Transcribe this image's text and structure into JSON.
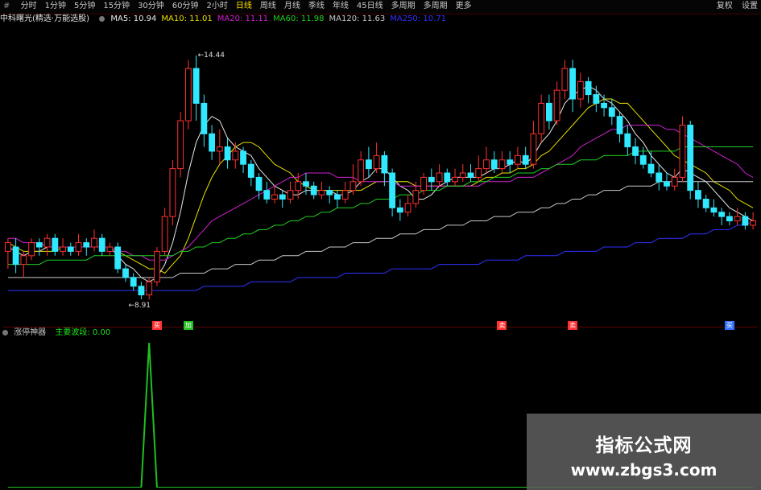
{
  "toolbar": {
    "first": "#",
    "periods": [
      "分时",
      "1分钟",
      "5分钟",
      "15分钟",
      "30分钟",
      "60分钟",
      "2小时",
      "日线",
      "周线",
      "月线",
      "季线",
      "年线",
      "45日线",
      "多周期",
      "多周期",
      "更多"
    ],
    "active_index": 7,
    "right": [
      "复权",
      "设置"
    ]
  },
  "legend": {
    "title": "中科曙光(精选·万能选股)",
    "items": [
      {
        "label": "MA5: 10.94",
        "color": "#e8e8e8"
      },
      {
        "label": "MA10: 11.01",
        "color": "#e8e000"
      },
      {
        "label": "MA20: 11.11",
        "color": "#d020d0"
      },
      {
        "label": "MA60: 11.98",
        "color": "#20d020"
      },
      {
        "label": "MA120: 11.63",
        "color": "#c8c8c8"
      },
      {
        "label": "MA250: 10.71",
        "color": "#3030ff"
      }
    ]
  },
  "price_labels": {
    "high": "14.44",
    "low": "8.91"
  },
  "signals": [
    {
      "text": "买",
      "color": "#ff3030"
    },
    {
      "text": "加",
      "color": "#20c020"
    },
    {
      "text": "卖",
      "color": "#ff3030"
    },
    {
      "text": "卖",
      "color": "#ff3030"
    },
    {
      "text": "买",
      "color": "#3070ff"
    }
  ],
  "sub": {
    "title": "涨停神器",
    "value_label": "主要波段: 0.00"
  },
  "watermark": {
    "cn": "指标公式网",
    "url": "www.zbgs3.com"
  },
  "chart_data": {
    "type": "candlestick",
    "ylim": [
      8.4,
      15.2
    ],
    "candles": [
      [
        10.0,
        10.2,
        9.6,
        10.3
      ],
      [
        10.1,
        9.7,
        9.5,
        10.3
      ],
      [
        9.7,
        9.9,
        9.4,
        10.0
      ],
      [
        9.9,
        10.2,
        9.8,
        10.3
      ],
      [
        10.2,
        10.1,
        9.9,
        10.3
      ],
      [
        10.1,
        10.3,
        9.9,
        10.4
      ],
      [
        10.3,
        10.0,
        9.9,
        10.4
      ],
      [
        10.0,
        10.1,
        9.9,
        10.3
      ],
      [
        10.1,
        10.0,
        9.9,
        10.2
      ],
      [
        10.0,
        10.2,
        9.9,
        10.4
      ],
      [
        10.2,
        10.1,
        9.9,
        10.3
      ],
      [
        10.1,
        10.3,
        10.0,
        10.5
      ],
      [
        10.3,
        10.0,
        9.9,
        10.4
      ],
      [
        10.0,
        10.1,
        9.9,
        10.2
      ],
      [
        10.1,
        9.6,
        9.5,
        10.2
      ],
      [
        9.6,
        9.4,
        9.3,
        9.7
      ],
      [
        9.4,
        9.2,
        9.1,
        9.5
      ],
      [
        9.2,
        9.0,
        8.9,
        9.3
      ],
      [
        9.0,
        9.3,
        8.9,
        9.4
      ],
      [
        9.3,
        10.0,
        9.2,
        10.1
      ],
      [
        10.0,
        10.8,
        9.9,
        11.0
      ],
      [
        10.8,
        11.9,
        10.6,
        12.1
      ],
      [
        11.9,
        13.0,
        11.7,
        13.2
      ],
      [
        13.0,
        14.2,
        12.8,
        14.4
      ],
      [
        14.2,
        13.4,
        13.0,
        14.5
      ],
      [
        13.4,
        12.7,
        12.4,
        13.6
      ],
      [
        12.7,
        12.3,
        12.1,
        12.9
      ],
      [
        12.3,
        12.4,
        12.0,
        12.8
      ],
      [
        12.4,
        12.1,
        11.9,
        12.6
      ],
      [
        12.1,
        12.3,
        11.9,
        12.5
      ],
      [
        12.3,
        12.0,
        11.8,
        12.4
      ],
      [
        12.0,
        11.7,
        11.5,
        12.1
      ],
      [
        11.7,
        11.4,
        11.2,
        11.8
      ],
      [
        11.4,
        11.2,
        11.1,
        11.6
      ],
      [
        11.2,
        11.3,
        11.1,
        11.5
      ],
      [
        11.3,
        11.2,
        11.0,
        11.4
      ],
      [
        11.2,
        11.4,
        11.1,
        11.6
      ],
      [
        11.4,
        11.6,
        11.2,
        11.8
      ],
      [
        11.6,
        11.5,
        11.3,
        11.8
      ],
      [
        11.5,
        11.3,
        11.2,
        11.6
      ],
      [
        11.3,
        11.4,
        11.2,
        11.6
      ],
      [
        11.4,
        11.3,
        11.1,
        11.5
      ],
      [
        11.3,
        11.2,
        11.0,
        11.4
      ],
      [
        11.2,
        11.4,
        11.1,
        11.6
      ],
      [
        11.4,
        11.6,
        11.3,
        12.0
      ],
      [
        11.6,
        12.1,
        11.5,
        12.3
      ],
      [
        12.1,
        11.9,
        11.7,
        12.4
      ],
      [
        11.9,
        12.2,
        11.8,
        12.5
      ],
      [
        12.2,
        11.8,
        11.5,
        12.3
      ],
      [
        11.8,
        11.0,
        10.8,
        11.9
      ],
      [
        11.0,
        10.9,
        10.7,
        11.2
      ],
      [
        10.9,
        11.1,
        10.8,
        11.3
      ],
      [
        11.1,
        11.4,
        11.0,
        11.6
      ],
      [
        11.4,
        11.7,
        11.3,
        11.8
      ],
      [
        11.7,
        11.6,
        11.4,
        11.9
      ],
      [
        11.6,
        11.8,
        11.5,
        12.0
      ],
      [
        11.8,
        11.6,
        11.5,
        11.9
      ],
      [
        11.6,
        11.7,
        11.5,
        11.9
      ],
      [
        11.7,
        11.8,
        11.6,
        12.0
      ],
      [
        11.8,
        11.7,
        11.6,
        12.0
      ],
      [
        11.7,
        11.9,
        11.6,
        12.2
      ],
      [
        11.9,
        12.1,
        11.8,
        12.4
      ],
      [
        12.1,
        11.9,
        11.8,
        12.3
      ],
      [
        11.9,
        12.1,
        11.8,
        12.3
      ],
      [
        12.1,
        12.0,
        11.8,
        12.3
      ],
      [
        12.0,
        12.2,
        11.9,
        12.4
      ],
      [
        12.2,
        12.0,
        11.9,
        12.4
      ],
      [
        12.0,
        12.7,
        11.9,
        13.0
      ],
      [
        12.7,
        13.4,
        12.5,
        13.6
      ],
      [
        13.4,
        13.0,
        12.8,
        13.6
      ],
      [
        13.0,
        13.7,
        12.9,
        13.9
      ],
      [
        13.7,
        14.2,
        13.5,
        14.4
      ],
      [
        14.2,
        13.5,
        13.2,
        14.4
      ],
      [
        13.5,
        13.9,
        13.3,
        14.1
      ],
      [
        13.9,
        13.6,
        13.4,
        14.0
      ],
      [
        13.6,
        13.4,
        13.2,
        13.8
      ],
      [
        13.4,
        13.3,
        13.1,
        13.6
      ],
      [
        13.3,
        13.1,
        12.9,
        13.5
      ],
      [
        13.1,
        12.7,
        12.5,
        13.2
      ],
      [
        12.7,
        12.4,
        12.2,
        12.9
      ],
      [
        12.4,
        12.2,
        12.0,
        12.6
      ],
      [
        12.2,
        12.0,
        11.9,
        12.4
      ],
      [
        12.0,
        11.8,
        11.7,
        12.3
      ],
      [
        11.8,
        11.6,
        11.4,
        12.0
      ],
      [
        11.6,
        11.5,
        11.4,
        11.8
      ],
      [
        11.5,
        11.7,
        11.4,
        11.9
      ],
      [
        11.7,
        12.9,
        11.6,
        13.1
      ],
      [
        12.9,
        11.4,
        11.2,
        13.0
      ],
      [
        11.4,
        11.2,
        11.0,
        11.6
      ],
      [
        11.2,
        11.0,
        10.9,
        11.3
      ],
      [
        11.0,
        10.9,
        10.8,
        11.2
      ],
      [
        10.9,
        10.8,
        10.6,
        11.0
      ],
      [
        10.8,
        10.7,
        10.6,
        10.9
      ],
      [
        10.7,
        10.8,
        10.6,
        11.0
      ],
      [
        10.8,
        10.6,
        10.5,
        10.9
      ],
      [
        10.6,
        10.7,
        10.5,
        10.9
      ]
    ],
    "ma": [
      {
        "name": "MA5",
        "color": "#e8e8e8",
        "values": [
          10.1,
          10.0,
          9.9,
          10.0,
          10.0,
          10.1,
          10.1,
          10.1,
          10.1,
          10.1,
          10.1,
          10.1,
          10.1,
          10.1,
          9.9,
          9.7,
          9.6,
          9.4,
          9.3,
          9.4,
          9.7,
          10.2,
          10.9,
          11.8,
          12.5,
          12.9,
          13.1,
          13.0,
          12.6,
          12.4,
          12.3,
          12.2,
          11.9,
          11.7,
          11.5,
          11.4,
          11.3,
          11.3,
          11.4,
          11.4,
          11.4,
          11.4,
          11.3,
          11.3,
          11.4,
          11.6,
          11.7,
          11.9,
          11.9,
          11.7,
          11.5,
          11.4,
          11.2,
          11.2,
          11.3,
          11.5,
          11.6,
          11.7,
          11.7,
          11.7,
          11.7,
          11.8,
          11.9,
          11.9,
          12.0,
          12.1,
          12.0,
          12.2,
          12.5,
          12.7,
          13.0,
          13.4,
          13.6,
          13.7,
          13.8,
          13.7,
          13.5,
          13.4,
          13.2,
          13.0,
          12.7,
          12.5,
          12.2,
          12.0,
          11.8,
          11.7,
          11.9,
          11.8,
          11.7,
          11.6,
          11.4,
          11.2,
          11.0,
          10.9,
          10.8,
          10.7
        ]
      },
      {
        "name": "MA10",
        "color": "#e8e000",
        "values": [
          10.2,
          10.1,
          10.0,
          10.0,
          10.0,
          10.0,
          10.0,
          10.1,
          10.1,
          10.1,
          10.1,
          10.1,
          10.1,
          10.1,
          10.0,
          9.9,
          9.8,
          9.7,
          9.6,
          9.6,
          9.5,
          9.7,
          9.9,
          10.3,
          10.8,
          11.3,
          11.7,
          12.0,
          12.2,
          12.4,
          12.5,
          12.5,
          12.4,
          12.2,
          12.0,
          11.9,
          11.8,
          11.6,
          11.5,
          11.4,
          11.4,
          11.4,
          11.4,
          11.4,
          11.4,
          11.4,
          11.5,
          11.6,
          11.6,
          11.6,
          11.6,
          11.6,
          11.5,
          11.5,
          11.5,
          11.5,
          11.5,
          11.5,
          11.5,
          11.5,
          11.6,
          11.7,
          11.7,
          11.8,
          11.8,
          11.9,
          11.9,
          12.0,
          12.2,
          12.3,
          12.5,
          12.7,
          12.9,
          13.1,
          13.3,
          13.4,
          13.5,
          13.5,
          13.4,
          13.4,
          13.2,
          13.0,
          12.8,
          12.6,
          12.4,
          12.2,
          12.1,
          12.0,
          11.9,
          11.8,
          11.6,
          11.5,
          11.4,
          11.2,
          11.1,
          11.0
        ]
      },
      {
        "name": "MA20",
        "color": "#d020d0",
        "values": [
          10.3,
          10.3,
          10.2,
          10.2,
          10.2,
          10.1,
          10.1,
          10.1,
          10.1,
          10.1,
          10.1,
          10.1,
          10.1,
          10.1,
          10.0,
          10.0,
          9.9,
          9.9,
          9.8,
          9.8,
          9.8,
          9.9,
          10.0,
          10.1,
          10.3,
          10.5,
          10.7,
          10.8,
          10.9,
          11.0,
          11.1,
          11.2,
          11.3,
          11.4,
          11.5,
          11.6,
          11.7,
          11.7,
          11.8,
          11.8,
          11.8,
          11.8,
          11.7,
          11.7,
          11.7,
          11.6,
          11.6,
          11.6,
          11.6,
          11.6,
          11.5,
          11.5,
          11.5,
          11.5,
          11.5,
          11.5,
          11.5,
          11.5,
          11.5,
          11.5,
          11.5,
          11.6,
          11.6,
          11.6,
          11.6,
          11.7,
          11.7,
          11.7,
          11.8,
          11.9,
          12.0,
          12.1,
          12.2,
          12.4,
          12.5,
          12.6,
          12.7,
          12.8,
          12.8,
          12.9,
          12.9,
          12.9,
          12.9,
          12.9,
          12.8,
          12.8,
          12.7,
          12.6,
          12.5,
          12.4,
          12.3,
          12.2,
          12.1,
          12.0,
          11.8,
          11.7
        ]
      },
      {
        "name": "MA60",
        "color": "#20d020",
        "values": [
          9.7,
          9.7,
          9.7,
          9.7,
          9.7,
          9.8,
          9.8,
          9.8,
          9.8,
          9.8,
          9.8,
          9.9,
          9.9,
          9.9,
          9.9,
          9.9,
          9.9,
          9.9,
          9.9,
          9.9,
          9.9,
          9.9,
          10.0,
          10.0,
          10.1,
          10.1,
          10.2,
          10.2,
          10.3,
          10.3,
          10.4,
          10.4,
          10.5,
          10.5,
          10.6,
          10.6,
          10.7,
          10.7,
          10.8,
          10.8,
          10.9,
          10.9,
          11.0,
          11.0,
          11.0,
          11.1,
          11.1,
          11.2,
          11.2,
          11.2,
          11.3,
          11.3,
          11.3,
          11.4,
          11.4,
          11.4,
          11.5,
          11.5,
          11.5,
          11.6,
          11.6,
          11.6,
          11.7,
          11.7,
          11.7,
          11.8,
          11.8,
          11.8,
          11.9,
          11.9,
          12.0,
          12.0,
          12.0,
          12.1,
          12.1,
          12.1,
          12.2,
          12.2,
          12.2,
          12.2,
          12.3,
          12.3,
          12.3,
          12.3,
          12.3,
          12.3,
          12.4,
          12.4,
          12.4,
          12.4,
          12.4,
          12.4,
          12.4,
          12.4,
          12.4,
          12.4
        ]
      },
      {
        "name": "MA120",
        "color": "#c8c8c8",
        "values": [
          9.4,
          9.4,
          9.4,
          9.4,
          9.4,
          9.4,
          9.4,
          9.4,
          9.4,
          9.4,
          9.4,
          9.4,
          9.4,
          9.4,
          9.4,
          9.4,
          9.4,
          9.4,
          9.4,
          9.4,
          9.4,
          9.4,
          9.5,
          9.5,
          9.5,
          9.5,
          9.6,
          9.6,
          9.6,
          9.7,
          9.7,
          9.7,
          9.8,
          9.8,
          9.8,
          9.9,
          9.9,
          9.9,
          10.0,
          10.0,
          10.0,
          10.1,
          10.1,
          10.1,
          10.2,
          10.2,
          10.2,
          10.3,
          10.3,
          10.3,
          10.4,
          10.4,
          10.4,
          10.5,
          10.5,
          10.5,
          10.6,
          10.6,
          10.6,
          10.7,
          10.7,
          10.7,
          10.8,
          10.8,
          10.8,
          10.9,
          10.9,
          10.9,
          11.0,
          11.0,
          11.1,
          11.1,
          11.2,
          11.2,
          11.3,
          11.3,
          11.4,
          11.4,
          11.4,
          11.5,
          11.5,
          11.5,
          11.5,
          11.6,
          11.6,
          11.6,
          11.6,
          11.6,
          11.6,
          11.6,
          11.6,
          11.6,
          11.6,
          11.6,
          11.6,
          11.6
        ]
      },
      {
        "name": "MA250",
        "color": "#3030ff",
        "values": [
          9.1,
          9.1,
          9.1,
          9.1,
          9.1,
          9.1,
          9.1,
          9.1,
          9.1,
          9.1,
          9.1,
          9.1,
          9.1,
          9.1,
          9.1,
          9.1,
          9.1,
          9.1,
          9.1,
          9.1,
          9.1,
          9.1,
          9.1,
          9.1,
          9.1,
          9.2,
          9.2,
          9.2,
          9.2,
          9.2,
          9.2,
          9.3,
          9.3,
          9.3,
          9.3,
          9.3,
          9.3,
          9.4,
          9.4,
          9.4,
          9.4,
          9.4,
          9.4,
          9.5,
          9.5,
          9.5,
          9.5,
          9.5,
          9.5,
          9.6,
          9.6,
          9.6,
          9.6,
          9.6,
          9.6,
          9.7,
          9.7,
          9.7,
          9.7,
          9.7,
          9.7,
          9.8,
          9.8,
          9.8,
          9.8,
          9.8,
          9.9,
          9.9,
          9.9,
          9.9,
          9.9,
          10.0,
          10.0,
          10.0,
          10.0,
          10.0,
          10.1,
          10.1,
          10.1,
          10.1,
          10.2,
          10.2,
          10.2,
          10.3,
          10.3,
          10.3,
          10.3,
          10.4,
          10.4,
          10.4,
          10.5,
          10.5,
          10.5,
          10.6,
          10.6,
          10.7
        ]
      }
    ],
    "signal_indices": [
      19,
      23,
      63,
      72,
      92
    ],
    "sub_values": {
      "spike_index": 18,
      "spike_value": 1.0,
      "ylim": [
        0,
        1
      ]
    }
  }
}
